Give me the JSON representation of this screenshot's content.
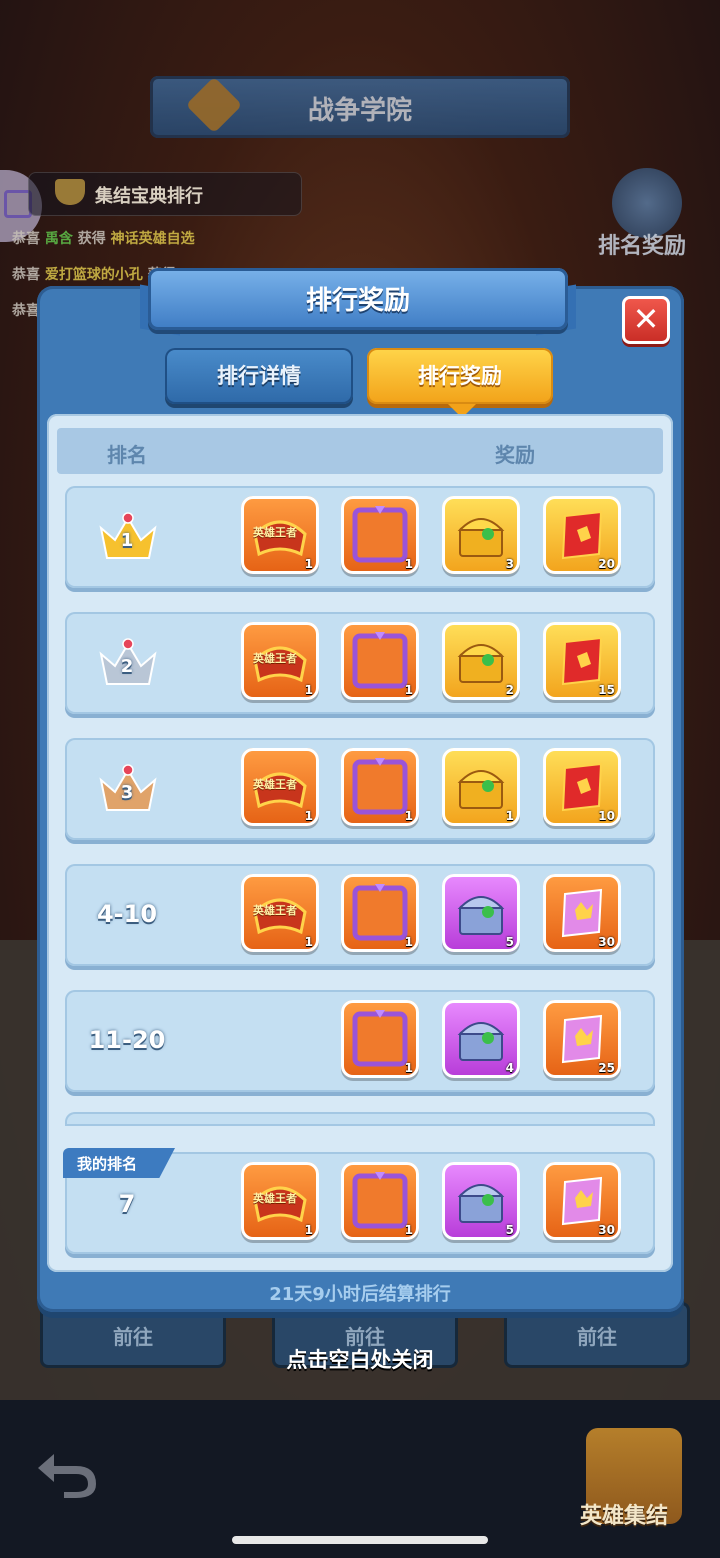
{
  "background": {
    "academy_title": "战争学院",
    "ranking_label": "集结宝典排行",
    "ticker": [
      {
        "prefix": "恭喜",
        "name": "禹含",
        "mid": "获得",
        "item": "神话英雄自选"
      },
      {
        "prefix": "恭喜",
        "name": "爱打篮球的小孔",
        "mid": "获得",
        "item": ""
      },
      {
        "prefix": "恭喜",
        "name": "",
        "mid": "",
        "item": ""
      }
    ],
    "rank_reward_button": "排名奖励",
    "go_buttons": [
      "前往",
      "前往",
      "前往"
    ],
    "hero_gather": "英雄集结"
  },
  "dialog": {
    "title": "排行奖励",
    "close": "✕",
    "tabs": {
      "detail": "排行详情",
      "reward": "排行奖励"
    },
    "columns": {
      "rank": "排名",
      "reward": "奖励"
    },
    "hero_badge_text": "英雄王者",
    "rows": [
      {
        "rank": "1",
        "crown": "gold",
        "rewards": [
          {
            "type": "hero-title",
            "count": "1"
          },
          {
            "type": "purple-frame",
            "count": "1"
          },
          {
            "type": "gold-chest",
            "count": "3"
          },
          {
            "type": "red-scroll",
            "count": "20"
          }
        ]
      },
      {
        "rank": "2",
        "crown": "silver",
        "rewards": [
          {
            "type": "hero-title",
            "count": "1"
          },
          {
            "type": "purple-frame",
            "count": "1"
          },
          {
            "type": "gold-chest",
            "count": "2"
          },
          {
            "type": "red-scroll",
            "count": "15"
          }
        ]
      },
      {
        "rank": "3",
        "crown": "bronze",
        "rewards": [
          {
            "type": "hero-title",
            "count": "1"
          },
          {
            "type": "purple-frame",
            "count": "1"
          },
          {
            "type": "gold-chest",
            "count": "1"
          },
          {
            "type": "red-scroll",
            "count": "10"
          }
        ]
      },
      {
        "rank": "4-10",
        "rewards": [
          {
            "type": "hero-title",
            "count": "1"
          },
          {
            "type": "purple-frame",
            "count": "1"
          },
          {
            "type": "purple-chest",
            "count": "5"
          },
          {
            "type": "pink-scroll",
            "count": "30"
          }
        ]
      },
      {
        "rank": "11-20",
        "rewards": [
          {
            "type": "purple-frame",
            "count": "1"
          },
          {
            "type": "purple-chest",
            "count": "4"
          },
          {
            "type": "pink-scroll",
            "count": "25"
          }
        ]
      }
    ],
    "my_rank": {
      "label": "我的排名",
      "rank": "7",
      "rewards": [
        {
          "type": "hero-title",
          "count": "1"
        },
        {
          "type": "purple-frame",
          "count": "1"
        },
        {
          "type": "purple-chest",
          "count": "5"
        },
        {
          "type": "pink-scroll",
          "count": "30"
        }
      ]
    },
    "settle_text": "21天9小时后结算排行",
    "tap_close": "点击空白处关闭"
  },
  "colors": {
    "gold": "#f6c12e",
    "silver": "#b9c6d6",
    "bronze": "#e0a36a",
    "accent_blue": "#3f7ab6",
    "tab_active": "#f2a219"
  }
}
